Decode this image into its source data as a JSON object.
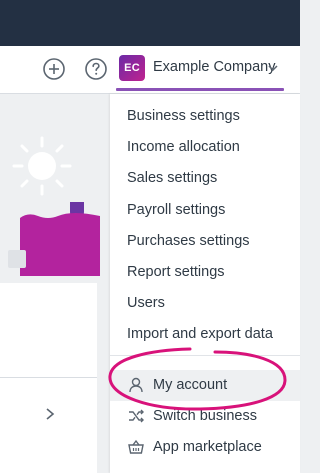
{
  "header": {
    "avatar_initials": "EC",
    "company_name": "Example Company",
    "add_icon": "plus-circle-icon",
    "help_icon": "help-circle-icon"
  },
  "menu": {
    "items": [
      {
        "label": "Business settings"
      },
      {
        "label": "Income allocation"
      },
      {
        "label": "Sales settings"
      },
      {
        "label": "Payroll settings"
      },
      {
        "label": "Purchases settings"
      },
      {
        "label": "Report settings"
      },
      {
        "label": "Users"
      },
      {
        "label": "Import and export data"
      }
    ],
    "account_items": [
      {
        "label": "My account",
        "icon": "user-icon"
      },
      {
        "label": "Switch business",
        "icon": "shuffle-icon"
      },
      {
        "label": "App marketplace",
        "icon": "basket-icon"
      }
    ]
  },
  "colors": {
    "topbar": "#233043",
    "accent_purple": "#8a52b6",
    "annotation_magenta": "#d8127a"
  }
}
